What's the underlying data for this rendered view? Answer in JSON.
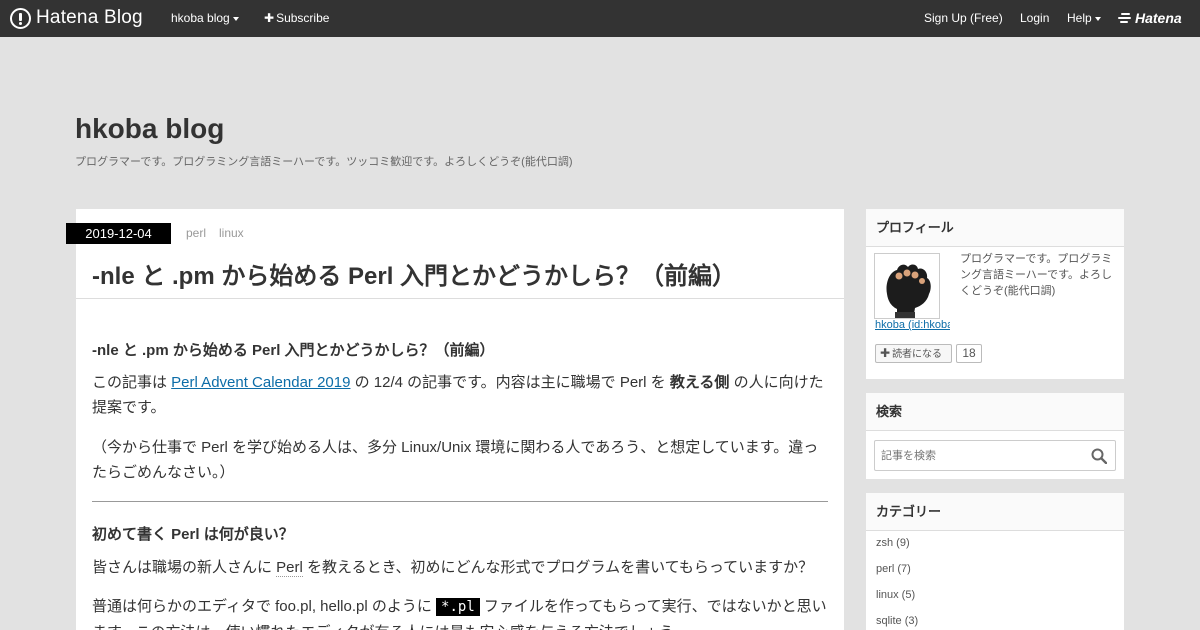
{
  "topbar": {
    "brand": "Hatena Blog",
    "blog_menu": "hkoba blog",
    "subscribe": "Subscribe",
    "signup": "Sign Up (Free)",
    "login": "Login",
    "help": "Help",
    "hatena": "Hatena"
  },
  "header": {
    "title": "hkoba blog",
    "description": "プログラマーです。プログラミング言語ミーハーです。ツッコミ歓迎です。よろしくどうぞ(能代口調)"
  },
  "entry": {
    "date": "2019-12-04",
    "categories": [
      "perl",
      "linux"
    ],
    "title": "-nle と .pm から始める Perl 入門とかどうかしら？（前編）",
    "heading1": "-nle と .pm から始める Perl 入門とかどうかしら？（前編）",
    "p1": {
      "a": "この記事は ",
      "link": "Perl Advent Calendar 2019",
      "b": " の 12/4 の記事です。内容は主に職場で Perl を ",
      "bold": "教える側",
      "c": " の人に向けた提案です。"
    },
    "p2": "（今から仕事で Perl を学び始める人は、多分 Linux/Unix 環境に関わる人であろう、と想定しています。違ったらごめんなさい。）",
    "heading2": "初めて書く Perl は何が良い？",
    "p3": {
      "a": "皆さんは職場の新人さんに ",
      "perl": "Perl",
      "b": " を教えるとき、初めにどんな形式でプログラムを書いてもらっていますか？"
    },
    "p4": {
      "a": "普通は何らかのエディタで foo.pl, hello.pl のように ",
      "code": "*.pl",
      "b": " ファイルを作ってもらって実行、ではないかと思います。この方法は、使い慣れたエディタが有る人には最も安心感を与える方法でしょう。"
    }
  },
  "sidebar": {
    "profile": {
      "heading": "プロフィール",
      "text": "プログラマーです。プログラミング言語ミーハーです。よろしくどうぞ(能代口調)",
      "id": "hkoba (id:hkoba)",
      "reader_button": "読者になる",
      "reader_count": "18"
    },
    "search": {
      "heading": "検索",
      "placeholder": "記事を検索"
    },
    "categories": {
      "heading": "カテゴリー",
      "items": [
        "zsh (9)",
        "perl (7)",
        "linux (5)",
        "sqlite (3)"
      ]
    }
  }
}
